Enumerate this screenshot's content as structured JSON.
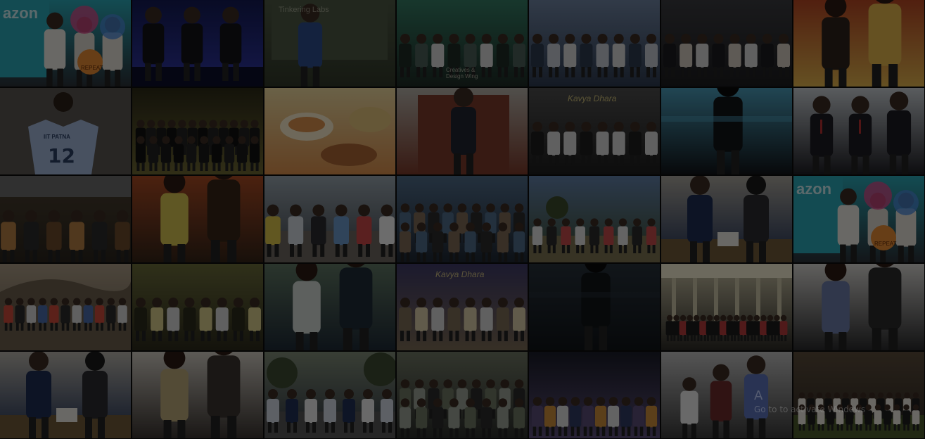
{
  "wall": {
    "tiles": [
      {
        "id": "r1c1",
        "theme": "party",
        "colors": [
          "#2aa7b6",
          "#2c3138",
          "#e58b34"
        ],
        "texts": [
          {
            "value": "azon",
            "kind": "sign"
          },
          {
            "value": "REPEAT",
            "kind": "badge"
          }
        ]
      },
      {
        "id": "r1c2",
        "theme": "stage",
        "colors": [
          "#131a52",
          "#3138a6",
          "#1b1b2a"
        ],
        "texts": []
      },
      {
        "id": "r1c3",
        "theme": "presenter",
        "colors": [
          "#4d5844",
          "#313829",
          "#2e4d8a"
        ],
        "texts": [
          {
            "value": "Tinkering Labs",
            "kind": "projector"
          }
        ]
      },
      {
        "id": "r1c4",
        "theme": "group",
        "colors": [
          "#347a63",
          "#1e2b25",
          "#4a5e58"
        ],
        "texts": [
          {
            "value": "Creatives & Design Wing",
            "kind": "caption"
          }
        ]
      },
      {
        "id": "r1c5",
        "theme": "group",
        "colors": [
          "#6e82a0",
          "#2d3a4f",
          "#c2c6cf"
        ],
        "texts": []
      },
      {
        "id": "r1c6",
        "theme": "group",
        "colors": [
          "#3a3b3f",
          "#1c1c1f",
          "#d1c8bd"
        ],
        "texts": []
      },
      {
        "id": "r1c7",
        "theme": "selfie",
        "colors": [
          "#b44623",
          "#e0b34d",
          "#2d231c"
        ],
        "texts": []
      },
      {
        "id": "r2c1",
        "theme": "jersey",
        "colors": [
          "#5a5550",
          "#9fb4d6",
          "#292624"
        ],
        "texts": [
          {
            "value": "IIT PATNA",
            "kind": "jersey"
          },
          {
            "value": "12",
            "kind": "number"
          }
        ]
      },
      {
        "id": "r2c2",
        "theme": "night",
        "colors": [
          "#2c2a17",
          "#6d6733",
          "#1a190f"
        ],
        "texts": []
      },
      {
        "id": "r2c3",
        "theme": "food",
        "colors": [
          "#ead79e",
          "#d88e4c",
          "#a86534"
        ],
        "texts": []
      },
      {
        "id": "r2c4",
        "theme": "portrait",
        "colors": [
          "#b3afa7",
          "#7a3a2a",
          "#2c2a28"
        ],
        "texts": []
      },
      {
        "id": "r2c5",
        "theme": "group",
        "colors": [
          "#4d4d4d",
          "#1d1d1d",
          "#d6d6d6"
        ],
        "texts": [
          {
            "value": "Kavya Dhara",
            "kind": "banner"
          }
        ]
      },
      {
        "id": "r2c6",
        "theme": "dark",
        "colors": [
          "#4a9bb8",
          "#111418",
          "#a6b8c2"
        ],
        "texts": []
      },
      {
        "id": "r2c7",
        "theme": "suits",
        "colors": [
          "#c6ccd1",
          "#1e1e24",
          "#b4302f"
        ],
        "texts": []
      },
      {
        "id": "r3c1",
        "theme": "lab",
        "colors": [
          "#4a3f30",
          "#2a241c",
          "#b27d43"
        ],
        "texts": []
      },
      {
        "id": "r3c2",
        "theme": "selfie",
        "colors": [
          "#a74a24",
          "#352418",
          "#d3c150"
        ],
        "texts": []
      },
      {
        "id": "r3c3",
        "theme": "beach",
        "colors": [
          "#97a3ac",
          "#3d434a",
          "#c48e38"
        ],
        "texts": []
      },
      {
        "id": "r3c4",
        "theme": "crowd",
        "colors": [
          "#4f6b87",
          "#1e2733",
          "#7c6856"
        ],
        "texts": []
      },
      {
        "id": "r3c5",
        "theme": "outdoor",
        "colors": [
          "#617fa7",
          "#3b4b2b",
          "#dedede"
        ],
        "texts": []
      },
      {
        "id": "r3c6",
        "theme": "award",
        "colors": [
          "#a8a49b",
          "#1e2e52",
          "#2b2b30"
        ],
        "texts": []
      },
      {
        "id": "r3c7",
        "theme": "party",
        "colors": [
          "#2aa7b6",
          "#2c3138",
          "#e58b34"
        ],
        "texts": [
          {
            "value": "azon",
            "kind": "sign"
          },
          {
            "value": "REPEAT",
            "kind": "badge"
          }
        ]
      },
      {
        "id": "r4c1",
        "theme": "hill",
        "colors": [
          "#a99a84",
          "#6a5e4d",
          "#3a3530"
        ],
        "texts": []
      },
      {
        "id": "r4c2",
        "theme": "group",
        "colors": [
          "#6a6b3a",
          "#2c2a1b",
          "#d4c98b"
        ],
        "texts": []
      },
      {
        "id": "r4c3",
        "theme": "selfie",
        "colors": [
          "#5f7663",
          "#1e2a36",
          "#cfd4d0"
        ],
        "texts": []
      },
      {
        "id": "r4c4",
        "theme": "group",
        "colors": [
          "#3e3a66",
          "#7a6a55",
          "#d8cba7"
        ],
        "texts": [
          {
            "value": "Kavya Dhara",
            "kind": "banner"
          }
        ]
      },
      {
        "id": "r4c5",
        "theme": "dark",
        "colors": [
          "#27313a",
          "#101418",
          "#6d7d8e"
        ],
        "texts": []
      },
      {
        "id": "r4c6",
        "theme": "formal",
        "colors": [
          "#c8c1a4",
          "#2c2a25",
          "#f0e9cf"
        ],
        "texts": []
      },
      {
        "id": "r4c7",
        "theme": "selfie",
        "colors": [
          "#d5d3cf",
          "#2a2a2c",
          "#6a7aa6"
        ],
        "texts": []
      },
      {
        "id": "r5c1",
        "theme": "award",
        "colors": [
          "#b5b1a8",
          "#1e2e52",
          "#2b2b30"
        ],
        "texts": []
      },
      {
        "id": "r5c2",
        "theme": "selfie",
        "colors": [
          "#cdc8bf",
          "#3a3430",
          "#b9a679"
        ],
        "texts": []
      },
      {
        "id": "r5c3",
        "theme": "walk",
        "colors": [
          "#7e8a76",
          "#2c3340",
          "#9fa6a3"
        ],
        "texts": []
      },
      {
        "id": "r5c4",
        "theme": "crowd",
        "colors": [
          "#6e7563",
          "#2b2d2a",
          "#9aa096"
        ],
        "texts": []
      },
      {
        "id": "r5c5",
        "theme": "nightgroup",
        "colors": [
          "#1a1c28",
          "#5a4d77",
          "#cfa865"
        ],
        "texts": []
      },
      {
        "id": "r5c6",
        "theme": "trio",
        "colors": [
          "#bdbdbd",
          "#3b3b3b",
          "#5b72b8"
        ],
        "texts": []
      },
      {
        "id": "r5c7",
        "theme": "team",
        "colors": [
          "#5a4b3a",
          "#2a2520",
          "#e8e4dc"
        ],
        "texts": []
      }
    ]
  },
  "system": {
    "activation_line1": "A",
    "activation_line2": "Go to   to activate Windows"
  }
}
